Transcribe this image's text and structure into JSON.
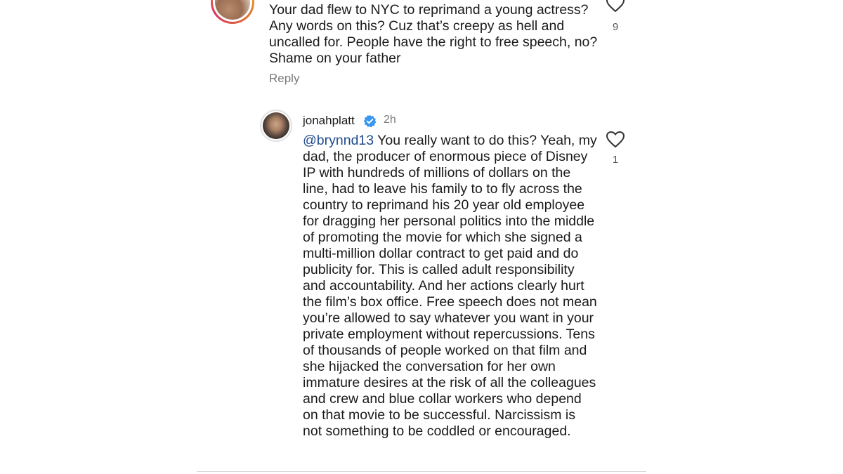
{
  "parent_comment": {
    "text": "Your dad flew to NYC to reprimand a young actress? Any words on this? Cuz that’s creepy as hell and uncalled for. People have the right to free speech, no? Shame on your father",
    "reply_label": "Reply",
    "like_count": "9"
  },
  "reply_comment": {
    "username": "jonahplatt",
    "time": "2h",
    "mention": "@brynnd13",
    "text": " You really want to do this? Yeah, my dad, the producer of enormous piece of Disney IP with hundreds of millions of dollars on the line, had to leave his family to to fly across the country to reprimand his 20 year old employee for dragging her personal politics into the middle of promoting the movie for which she signed a multi-million dollar contract to get paid and do publicity for. This is called adult responsibility and accountability. And her actions clearly hurt the film’s box office. Free speech does not mean you’re allowed to say whatever you want in your private employment without repercussions. Tens of thousands of people worked on that film and she hijacked the conversation for her own immature desires at the risk of all the colleagues and crew and blue collar workers who depend on that movie to be successful. Narcissism is not something to be coddled or encouraged.",
    "like_count": "1"
  },
  "icons": {
    "heart": "heart-icon",
    "verified": "verified-badge-icon"
  },
  "colors": {
    "verified_blue": "#3897f0",
    "mention_blue": "#1f4a8c",
    "muted_gray": "#7a7a7a"
  }
}
